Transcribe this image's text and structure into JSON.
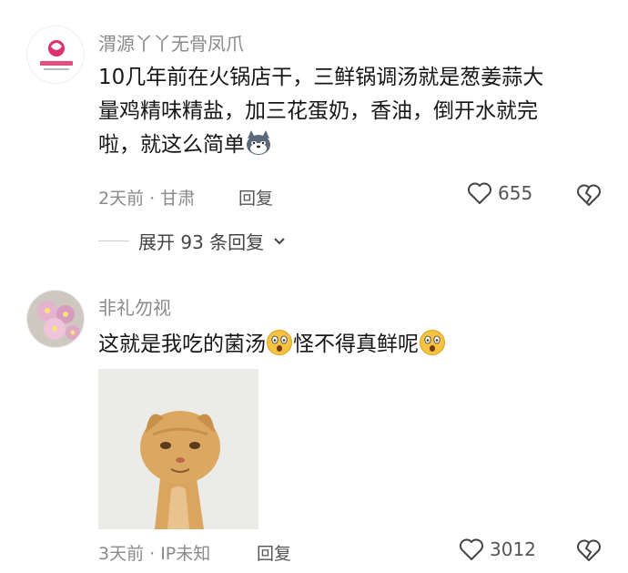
{
  "comments": [
    {
      "username": "渭源丫丫无骨凤爪",
      "avatar_text": "丫丫无骨凤爪",
      "text_line1": "10几年前在火锅店干，三鲜锅调汤就是葱姜蒜大",
      "text_line2": "量鸡精味精盐，加三花蛋奶，香油，倒开水就完",
      "text_line3": "啦，就这么简单",
      "meta": "2天前 · 甘肃",
      "reply_label": "回复",
      "likes": "655",
      "expand_label": "展开 93 条回复",
      "emoji_icon": "husky-dog-icon"
    },
    {
      "username": "非礼勿视",
      "text_part1": "这就是我吃的菌汤",
      "text_part2": "怪不得真鲜呢",
      "emoji_icon": "surprised-face-icon",
      "image_icon": "orange-cat-photo",
      "meta": "3天前 · IP未知",
      "reply_label": "回复",
      "likes": "3012"
    }
  ]
}
